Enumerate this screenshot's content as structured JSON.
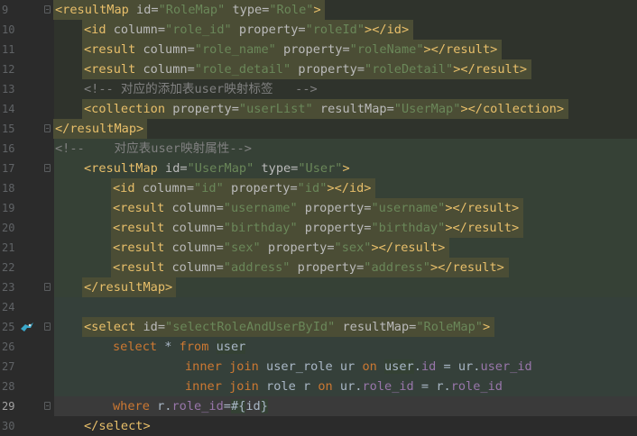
{
  "editor": {
    "lines": [
      {
        "no": "9",
        "indent": 0,
        "bg": "tag",
        "tokens": [
          {
            "t": "<resultMap ",
            "c": "tag"
          },
          {
            "t": "id=",
            "c": "attr"
          },
          {
            "t": "\"RoleMap\"",
            "c": "val"
          },
          {
            "t": " type=",
            "c": "attr"
          },
          {
            "t": "\"Role\"",
            "c": "val"
          },
          {
            "t": ">",
            "c": "tag"
          }
        ]
      },
      {
        "no": "10",
        "indent": 1,
        "bg": "tag",
        "tokens": [
          {
            "t": "<id ",
            "c": "tag"
          },
          {
            "t": "column=",
            "c": "attr"
          },
          {
            "t": "\"role_id\"",
            "c": "val"
          },
          {
            "t": " property=",
            "c": "attr"
          },
          {
            "t": "\"roleId\"",
            "c": "val"
          },
          {
            "t": "></id>",
            "c": "tag"
          }
        ]
      },
      {
        "no": "11",
        "indent": 1,
        "bg": "tag",
        "tokens": [
          {
            "t": "<result ",
            "c": "tag"
          },
          {
            "t": "column=",
            "c": "attr"
          },
          {
            "t": "\"role_name\"",
            "c": "val"
          },
          {
            "t": " property=",
            "c": "attr"
          },
          {
            "t": "\"roleName\"",
            "c": "val"
          },
          {
            "t": "></result>",
            "c": "tag"
          }
        ]
      },
      {
        "no": "12",
        "indent": 1,
        "bg": "tag",
        "tokens": [
          {
            "t": "<result ",
            "c": "tag"
          },
          {
            "t": "column=",
            "c": "attr"
          },
          {
            "t": "\"role_detail\"",
            "c": "val"
          },
          {
            "t": " property=",
            "c": "attr"
          },
          {
            "t": "\"roleDetail\"",
            "c": "val"
          },
          {
            "t": "></result>",
            "c": "tag"
          }
        ]
      },
      {
        "no": "13",
        "indent": 1,
        "bg": "none",
        "tokens": [
          {
            "t": "<!-- 对应的添加表user映射标签   -->",
            "c": "cmt"
          }
        ]
      },
      {
        "no": "14",
        "indent": 1,
        "bg": "tag",
        "tokens": [
          {
            "t": "<collection ",
            "c": "tag"
          },
          {
            "t": "property=",
            "c": "attr"
          },
          {
            "t": "\"userList\"",
            "c": "val"
          },
          {
            "t": " resultMap=",
            "c": "attr"
          },
          {
            "t": "\"UserMap\"",
            "c": "val"
          },
          {
            "t": "></collection>",
            "c": "tag"
          }
        ]
      },
      {
        "no": "15",
        "indent": 0,
        "bg": "tag",
        "tokens": [
          {
            "t": "</resultMap>",
            "c": "tag"
          }
        ]
      },
      {
        "no": "16",
        "indent": 0,
        "bg": "none",
        "tokens": [
          {
            "t": "<!--    对应表user映射属性-->",
            "c": "cmt"
          }
        ]
      },
      {
        "no": "17",
        "indent": 1,
        "bg": "none",
        "tokens": [
          {
            "t": "<resultMap ",
            "c": "tag"
          },
          {
            "t": "id=",
            "c": "attr"
          },
          {
            "t": "\"UserMap\"",
            "c": "val"
          },
          {
            "t": " type=",
            "c": "attr"
          },
          {
            "t": "\"User\"",
            "c": "val"
          },
          {
            "t": ">",
            "c": "tag"
          }
        ]
      },
      {
        "no": "18",
        "indent": 2,
        "bg": "tag",
        "tokens": [
          {
            "t": "<id ",
            "c": "tag"
          },
          {
            "t": "column=",
            "c": "attr"
          },
          {
            "t": "\"id\"",
            "c": "val"
          },
          {
            "t": " property=",
            "c": "attr"
          },
          {
            "t": "\"id\"",
            "c": "val"
          },
          {
            "t": "></id>",
            "c": "tag"
          }
        ]
      },
      {
        "no": "19",
        "indent": 2,
        "bg": "tag",
        "tokens": [
          {
            "t": "<result ",
            "c": "tag"
          },
          {
            "t": "column=",
            "c": "attr"
          },
          {
            "t": "\"username\"",
            "c": "val"
          },
          {
            "t": " property=",
            "c": "attr"
          },
          {
            "t": "\"username\"",
            "c": "val"
          },
          {
            "t": "></result>",
            "c": "tag"
          }
        ]
      },
      {
        "no": "20",
        "indent": 2,
        "bg": "tag",
        "tokens": [
          {
            "t": "<result ",
            "c": "tag"
          },
          {
            "t": "column=",
            "c": "attr"
          },
          {
            "t": "\"birthday\"",
            "c": "val"
          },
          {
            "t": " property=",
            "c": "attr"
          },
          {
            "t": "\"birthday\"",
            "c": "val"
          },
          {
            "t": "></result>",
            "c": "tag"
          }
        ]
      },
      {
        "no": "21",
        "indent": 2,
        "bg": "tag",
        "tokens": [
          {
            "t": "<result ",
            "c": "tag"
          },
          {
            "t": "column=",
            "c": "attr"
          },
          {
            "t": "\"sex\"",
            "c": "val"
          },
          {
            "t": " property=",
            "c": "attr"
          },
          {
            "t": "\"sex\"",
            "c": "val"
          },
          {
            "t": "></result>",
            "c": "tag"
          }
        ]
      },
      {
        "no": "22",
        "indent": 2,
        "bg": "tag",
        "tokens": [
          {
            "t": "<result ",
            "c": "tag"
          },
          {
            "t": "column=",
            "c": "attr"
          },
          {
            "t": "\"address\"",
            "c": "val"
          },
          {
            "t": " property=",
            "c": "attr"
          },
          {
            "t": "\"address\"",
            "c": "val"
          },
          {
            "t": "></result>",
            "c": "tag"
          }
        ]
      },
      {
        "no": "23",
        "indent": 1,
        "bg": "tag",
        "tokens": [
          {
            "t": "</resultMap>",
            "c": "tag"
          }
        ]
      },
      {
        "no": "24",
        "indent": 0,
        "bg": "none",
        "tokens": []
      },
      {
        "no": "25",
        "indent": 1,
        "bg": "tag",
        "tokens": [
          {
            "t": "<select ",
            "c": "tag"
          },
          {
            "t": "id=",
            "c": "attr"
          },
          {
            "t": "\"selectRoleAndUserById\"",
            "c": "val"
          },
          {
            "t": " resultMap=",
            "c": "attr"
          },
          {
            "t": "\"RoleMap\"",
            "c": "val"
          },
          {
            "t": ">",
            "c": "tag"
          }
        ]
      },
      {
        "no": "26",
        "indent": 2,
        "bg": "none",
        "tokens": [
          {
            "t": "select ",
            "c": "kw"
          },
          {
            "t": "* ",
            "c": "plain"
          },
          {
            "t": "from ",
            "c": "kw"
          },
          {
            "t": "user",
            "c": "plain",
            "box": true
          }
        ]
      },
      {
        "no": "27",
        "indent": 4.5,
        "bg": "none",
        "tokens": [
          {
            "t": "inner join ",
            "c": "kw"
          },
          {
            "t": "user_role ",
            "c": "plain"
          },
          {
            "t": "ur ",
            "c": "plain"
          },
          {
            "t": "on ",
            "c": "kw"
          },
          {
            "t": "user",
            "c": "plain",
            "box": true
          },
          {
            "t": ".",
            "c": "plain"
          },
          {
            "t": "id",
            "c": "col"
          },
          {
            "t": " = ",
            "c": "plain"
          },
          {
            "t": "ur.",
            "c": "plain"
          },
          {
            "t": "user_id",
            "c": "col"
          }
        ]
      },
      {
        "no": "28",
        "indent": 4.5,
        "bg": "none",
        "tokens": [
          {
            "t": "inner join ",
            "c": "kw"
          },
          {
            "t": "role ",
            "c": "plain"
          },
          {
            "t": "r ",
            "c": "plain"
          },
          {
            "t": "on ",
            "c": "kw"
          },
          {
            "t": "ur.",
            "c": "plain"
          },
          {
            "t": "role_id",
            "c": "col"
          },
          {
            "t": " = ",
            "c": "plain"
          },
          {
            "t": "r.",
            "c": "plain"
          },
          {
            "t": "role_id",
            "c": "col"
          }
        ]
      },
      {
        "no": "29",
        "indent": 2,
        "bg": "cur",
        "tokens": [
          {
            "t": "where ",
            "c": "kw"
          },
          {
            "t": "r.",
            "c": "plain"
          },
          {
            "t": "role_id",
            "c": "col"
          },
          {
            "t": "=",
            "c": "plain"
          },
          {
            "t": "#{",
            "c": "plain",
            "box": true
          },
          {
            "t": "id",
            "c": "plain"
          },
          {
            "t": "}",
            "c": "plain",
            "box": true
          }
        ]
      },
      {
        "no": "30",
        "indent": 1,
        "bg": "none",
        "tokens": [
          {
            "t": "</select>",
            "c": "tag"
          }
        ]
      }
    ]
  },
  "colors": {
    "background": "#2b2b2b",
    "tag_highlight": "#4b4d35",
    "block_highlight": "#364136",
    "current_line": "#323232"
  },
  "icons": {
    "gutter_mapper": "mybatis-bird-icon"
  }
}
